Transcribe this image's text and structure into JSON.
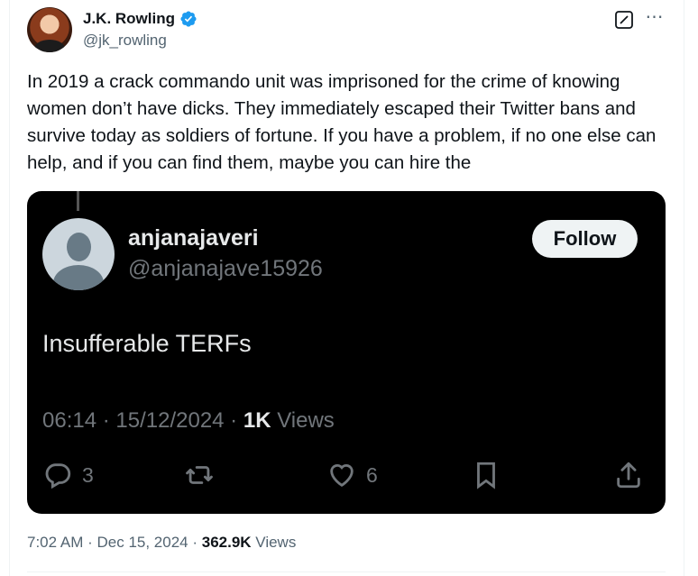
{
  "author": {
    "name": "J.K. Rowling",
    "handle": "@jk_rowling",
    "verified": true,
    "verified_color": "#1d9bf0"
  },
  "header_icons": [
    "grok-icon",
    "more-icon"
  ],
  "tweet": {
    "text": "In 2019 a crack commando unit was imprisoned for the crime of knowing women don’t have dicks. They immediately escaped their Twitter bans and survive today as soldiers of fortune. If you have a problem, if no one else can help, and if you can find them, maybe you can hire the"
  },
  "embedded": {
    "name": "anjanajaveri",
    "handle": "@anjanajave15926",
    "follow_label": "Follow",
    "text": "Insufferable TERFs",
    "time": "06:14",
    "date": "15/12/2024",
    "views_count": "1K",
    "views_label": "Views",
    "replies": "3",
    "likes": "6",
    "background": "#000000"
  },
  "footer": {
    "time": "7:02 AM",
    "date": "Dec 15, 2024",
    "views_count": "362.9K",
    "views_label": "Views"
  }
}
